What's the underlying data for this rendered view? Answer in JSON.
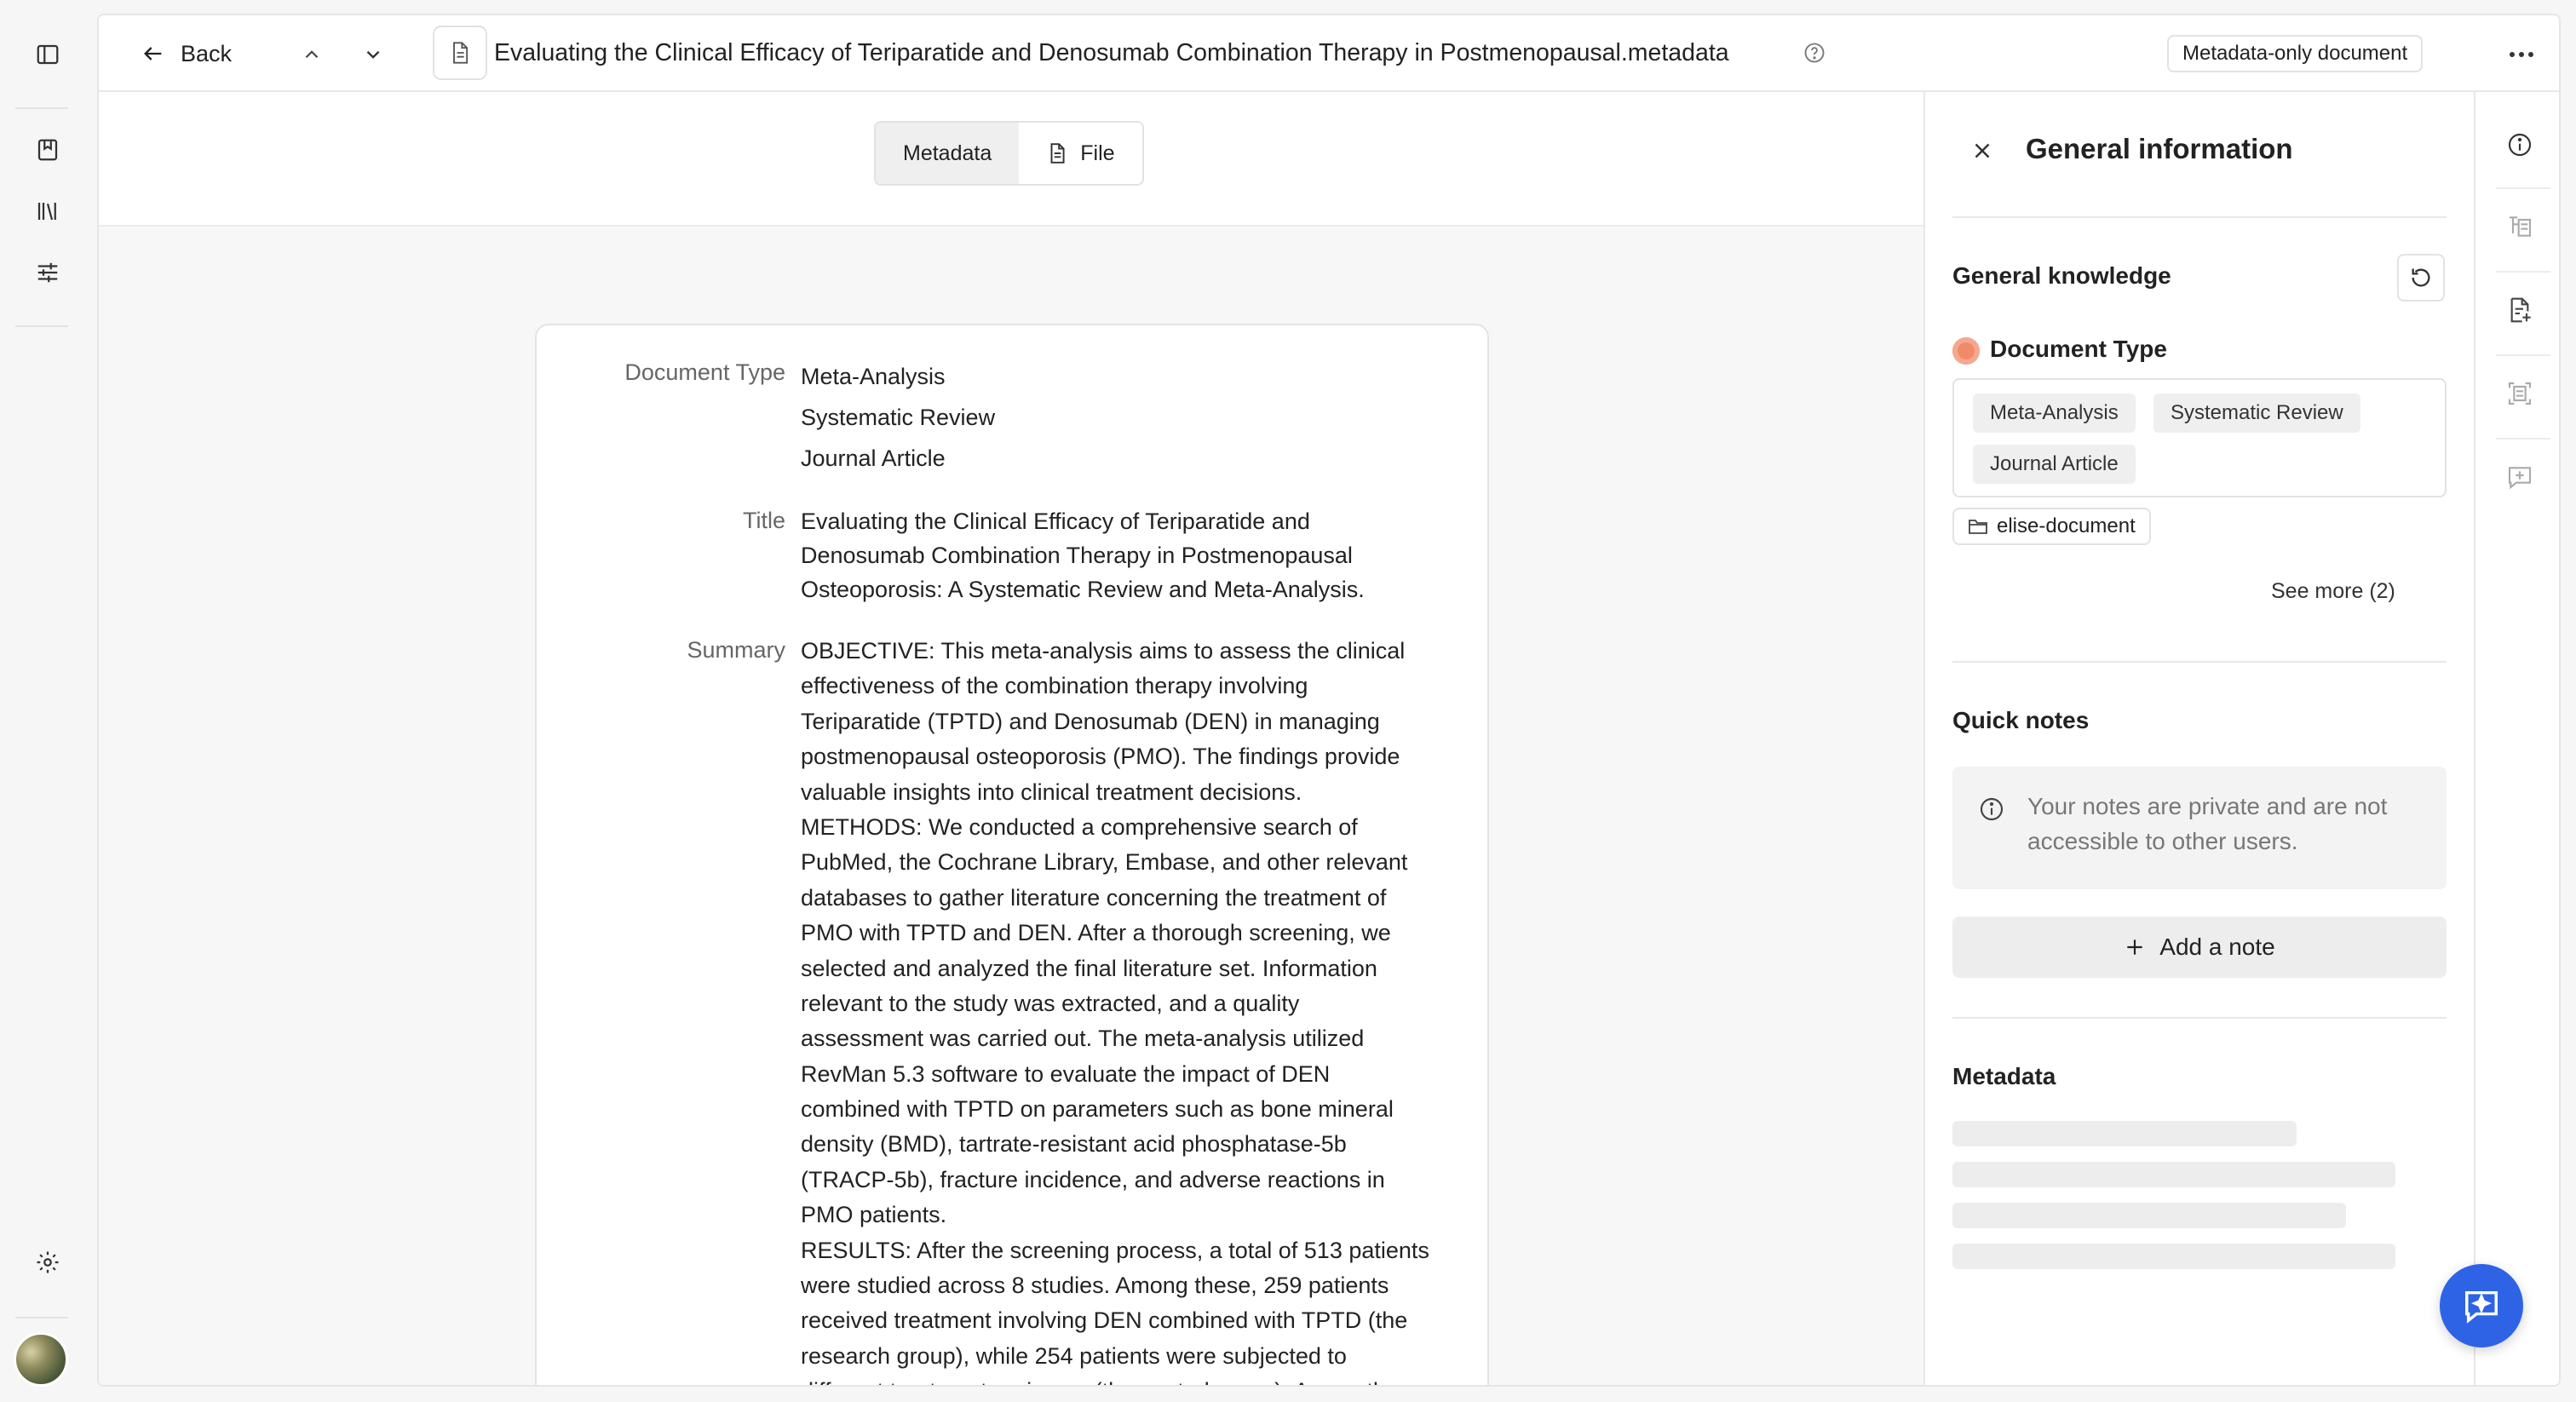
{
  "topbar": {
    "back_label": "Back",
    "document_title": "Evaluating the Clinical Efficacy of Teriparatide and Denosumab Combination Therapy in Postmenopausal.metadata",
    "badge": "Metadata-only document"
  },
  "view_tabs": [
    {
      "label": "Metadata",
      "active": true
    },
    {
      "label": "File",
      "active": false
    }
  ],
  "document": {
    "doc_type_label": "Document Type",
    "doc_types": [
      "Meta-Analysis",
      "Systematic Review",
      "Journal Article"
    ],
    "title_label": "Title",
    "title_lines": [
      "Evaluating the Clinical Efficacy of Teriparatide and",
      "Denosumab Combination Therapy in Postmenopausal",
      "Osteoporosis: A Systematic Review and Meta-Analysis."
    ],
    "summary_label": "Summary",
    "summary_lines": [
      "OBJECTIVE: This meta-analysis aims to assess the clinical",
      "effectiveness of the combination therapy involving",
      "Teriparatide (TPTD) and Denosumab (DEN) in managing",
      "postmenopausal osteoporosis (PMO). The findings provide",
      "valuable insights into clinical treatment decisions.",
      "METHODS: We conducted a comprehensive search of",
      "PubMed, the Cochrane Library, Embase, and other relevant",
      "databases to gather literature concerning the treatment of",
      "PMO with TPTD and DEN. After a thorough screening, we",
      "selected and analyzed the final literature set. Information",
      "relevant to the study was extracted, and a quality",
      "assessment was carried out. The meta-analysis utilized",
      "RevMan 5.3 software to evaluate the impact of DEN",
      "combined with TPTD on parameters such as bone mineral",
      "density (BMD), tartrate-resistant acid phosphatase-5b",
      "(TRACP-5b), fracture incidence, and adverse reactions in",
      "PMO patients.",
      "RESULTS: After the screening process, a total of 513 patients",
      "were studied across 8 studies. Among these, 259 patients",
      "received treatment involving DEN combined with TPTD (the",
      "research group), while 254 patients were subjected to",
      "different treatment regimens (the control group). As per the"
    ]
  },
  "panel": {
    "title": "General information",
    "general_knowledge": "General knowledge",
    "document_type_label": "Document Type",
    "document_type_color": "#f08a6a",
    "chips": [
      "Meta-Analysis",
      "Systematic Review",
      "Journal Article"
    ],
    "folder_chip": "elise-document",
    "see_more": "See more (2)",
    "quick_notes": "Quick notes",
    "notes_hint": "Your notes are private and are not accessible to other users.",
    "add_note": "Add a note",
    "metadata": "Metadata"
  },
  "colors": {
    "accent": "#2e63e6"
  }
}
